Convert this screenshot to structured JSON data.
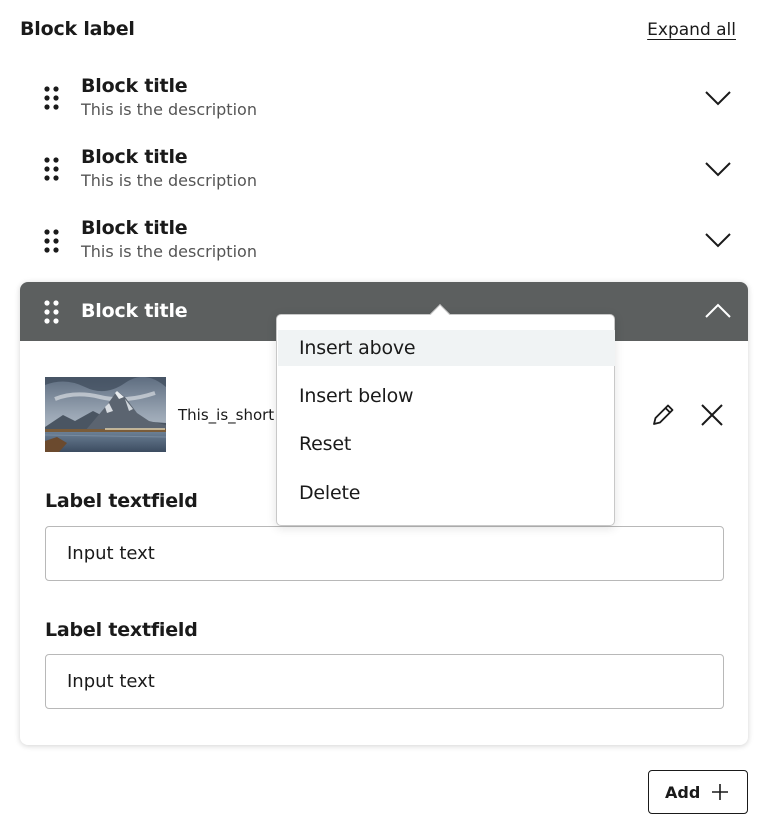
{
  "header": {
    "label": "Block label",
    "expand_all": "Expand all"
  },
  "blocks": [
    {
      "title": "Block title",
      "description": "This is the description"
    },
    {
      "title": "Block title",
      "description": "This is the description"
    },
    {
      "title": "Block title",
      "description": "This is the description"
    }
  ],
  "expanded_block": {
    "title": "Block title",
    "file_name": "This_is_short",
    "fields": [
      {
        "label": "Label textfield",
        "value": "Input text"
      },
      {
        "label": "Label textfield",
        "value": "Input text"
      }
    ]
  },
  "context_menu": {
    "items": [
      "Insert above",
      "Insert below",
      "Reset",
      "Delete"
    ],
    "active_index": 0
  },
  "add_button": {
    "label": "Add"
  },
  "colors": {
    "header_bg": "#5c5f5f",
    "menu_active_bg": "#f0f3f4",
    "border": "#b8b8b8"
  },
  "icons": {
    "drag": "drag-handle-icon",
    "expand": "chevron-down-icon",
    "collapse": "chevron-up-icon",
    "edit": "pencil-icon",
    "remove": "close-icon",
    "add": "plus-icon"
  }
}
